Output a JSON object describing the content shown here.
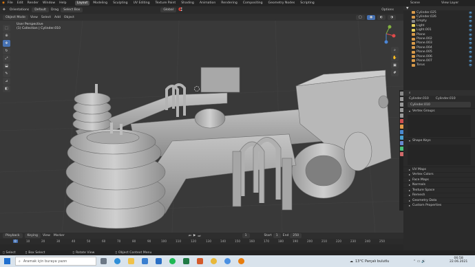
{
  "menu": [
    "File",
    "Edit",
    "Render",
    "Window",
    "Help"
  ],
  "workspaces": [
    "Layout",
    "Modeling",
    "Sculpting",
    "UV Editing",
    "Texture Paint",
    "Shading",
    "Animation",
    "Rendering",
    "Compositing",
    "Geometry Nodes",
    "Scripting"
  ],
  "scene": "Scene",
  "view_layer": "View Layer",
  "header2": {
    "orientation": "Orientations",
    "default": "Default",
    "drag": "Drag",
    "select_box": "Select Box",
    "global": "Global",
    "options": "Options"
  },
  "header3": {
    "mode": "Object Mode",
    "items": [
      "View",
      "Select",
      "Add",
      "Object"
    ]
  },
  "viewport": {
    "perspective": "User Perspective",
    "collection": "(1) Collection | Cylinder.010"
  },
  "outliner": [
    "Cylinder.025",
    "Cylinder.026",
    "Empty",
    "Light",
    "Light.001",
    "Plane",
    "Plane.002",
    "Plane.003",
    "Plane.004",
    "Plane.005",
    "Plane.006",
    "Plane.007",
    "Torus"
  ],
  "props": {
    "object_name": "Cylinder.010",
    "data_name": "Cylinder.010",
    "mesh": "Cylinder.010",
    "vertex_groups": "Vertex Groups",
    "shape_keys": "Shape Keys",
    "sections": [
      "UV Maps",
      "Vertex Colors",
      "Face Maps",
      "Normals",
      "Texture Space",
      "Remesh",
      "Geometry Data",
      "Custom Properties"
    ]
  },
  "timeline": {
    "playback": "Playback",
    "keying": "Keying",
    "view": "View",
    "marker": "Marker",
    "current": "1",
    "start_label": "Start",
    "start": "1",
    "end_label": "End",
    "end": "250",
    "ticks": [
      "0",
      "10",
      "20",
      "30",
      "40",
      "50",
      "60",
      "70",
      "80",
      "90",
      "100",
      "110",
      "120",
      "130",
      "140",
      "150",
      "160",
      "170",
      "180",
      "190",
      "200",
      "210",
      "220",
      "230",
      "240",
      "250"
    ]
  },
  "status": {
    "select": "Select",
    "box_select": "Box Select",
    "rotate_view": "Rotate View",
    "context_menu": "Object Context Menu"
  },
  "taskbar": {
    "search_placeholder": "Aramak için buraya yazın",
    "weather": "13°C  Parçalı bulutlu",
    "time": "06:58",
    "date": "22.06.2021"
  },
  "colors": {
    "accent": "#4772b3",
    "active_tab": "#4a4a4a",
    "taskbar": "#d9e3ec",
    "object_orange": "#d89a4a"
  }
}
